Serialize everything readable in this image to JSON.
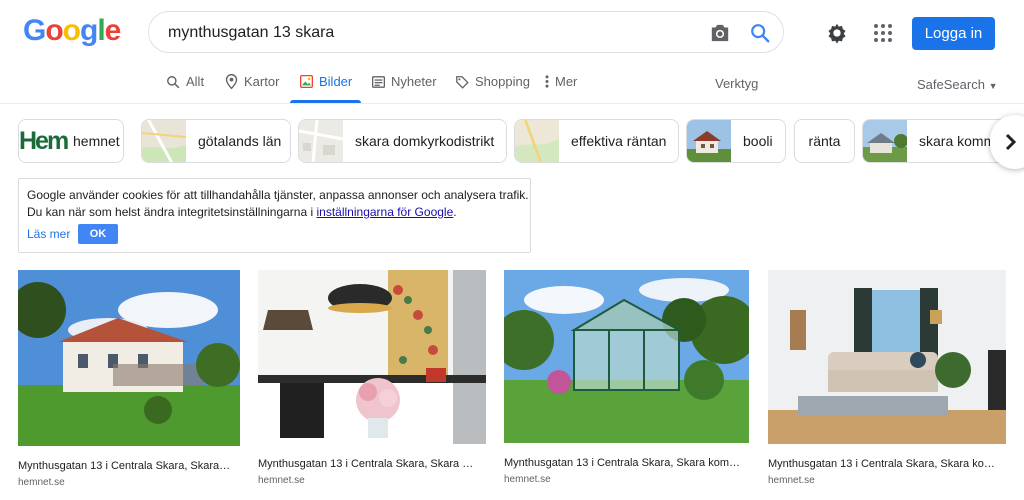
{
  "logo": {
    "letters": [
      "G",
      "o",
      "o",
      "g",
      "l",
      "e"
    ],
    "colors": [
      "#4285f4",
      "#ea4335",
      "#fbbc05",
      "#4285f4",
      "#34a853",
      "#ea4335"
    ]
  },
  "search": {
    "query": "mynthusgatan 13 skara"
  },
  "header": {
    "login_label": "Logga in"
  },
  "tabs": [
    {
      "label": "Allt",
      "icon": "search-icon"
    },
    {
      "label": "Kartor",
      "icon": "map-pin-icon"
    },
    {
      "label": "Bilder",
      "icon": "image-icon"
    },
    {
      "label": "Nyheter",
      "icon": "news-icon"
    },
    {
      "label": "Shopping",
      "icon": "tag-icon"
    },
    {
      "label": "Mer",
      "icon": "more-vert-icon"
    }
  ],
  "tools_label": "Verktyg",
  "safesearch_label": "SafeSearch",
  "chips": [
    {
      "label": "hemnet",
      "thumb_text": "Hem"
    },
    {
      "label": "götalands län"
    },
    {
      "label": "skara domkyrkodistrikt"
    },
    {
      "label": "effektiva räntan"
    },
    {
      "label": "booli"
    },
    {
      "label": "ränta"
    },
    {
      "label": "skara kommun"
    }
  ],
  "cookie": {
    "line1": "Google använder cookies för att tillhandahålla tjänster, anpassa annonser och analysera trafik.",
    "line2_prefix": "Du kan när som helst ändra integritetsinställningarna i ",
    "line2_link": "inställningarna för Google",
    "line2_suffix": ".",
    "learn_more": "Läs mer",
    "ok": "OK"
  },
  "results": [
    {
      "title": "Mynthusgatan 13 i Centrala Skara, Skara…",
      "source": "hemnet.se"
    },
    {
      "title": "Mynthusgatan 13 i Centrala Skara, Skara …",
      "source": "hemnet.se"
    },
    {
      "title": "Mynthusgatan 13 i Centrala Skara, Skara kom…",
      "source": "hemnet.se"
    },
    {
      "title": "Mynthusgatan 13 i Centrala Skara, Skara ko…",
      "source": "hemnet.se"
    }
  ]
}
